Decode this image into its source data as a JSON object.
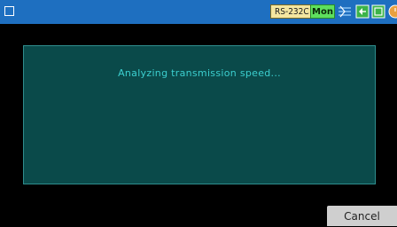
{
  "status_bar": {
    "port_label": "RS-232C",
    "mode_label": "Mon",
    "icons": [
      "menu-icon",
      "signal-icon",
      "connector-icon",
      "card-icon",
      "clock-icon"
    ]
  },
  "dialog": {
    "message": "Analyzing transmission speed..."
  },
  "actions": {
    "cancel_label": "Cancel"
  },
  "colors": {
    "topbar": "#1e6fc0",
    "dialog_bg": "#0a4a4a",
    "dialog_border": "#2f8d8d",
    "message_text": "#3ccfcf",
    "mode_badge": "#5ee05e",
    "port_badge": "#f3e6a0"
  }
}
